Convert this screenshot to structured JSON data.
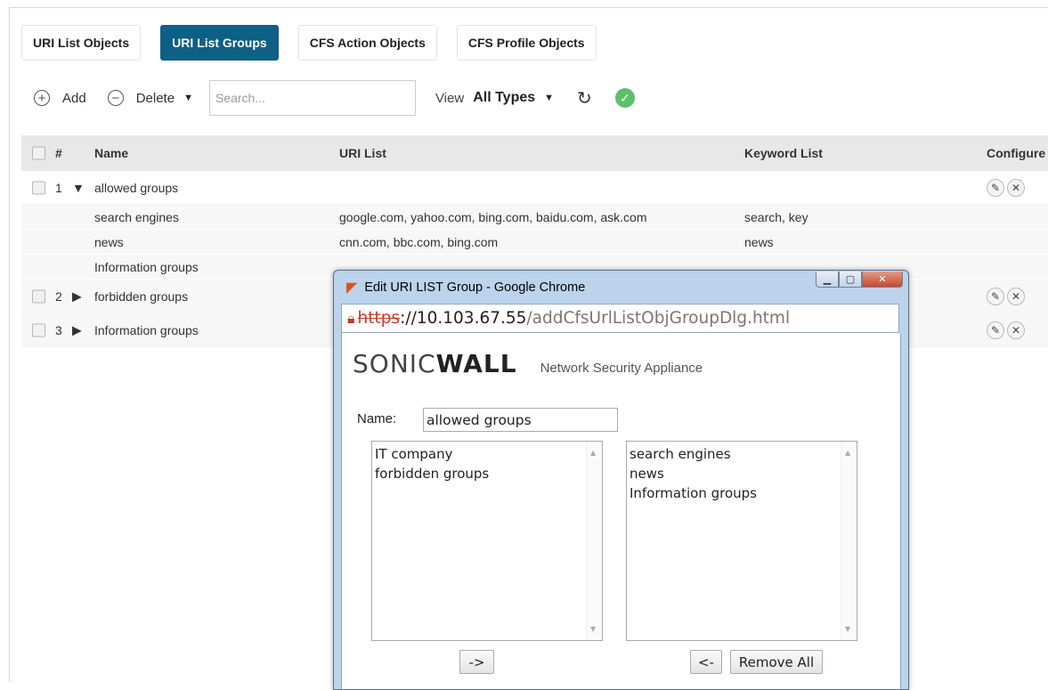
{
  "tabs": [
    {
      "label": "URI List Objects",
      "active": false
    },
    {
      "label": "URI List Groups",
      "active": true
    },
    {
      "label": "CFS Action Objects",
      "active": false
    },
    {
      "label": "CFS Profile Objects",
      "active": false
    }
  ],
  "toolbar": {
    "add_label": "Add",
    "delete_label": "Delete",
    "search_placeholder": "Search...",
    "view_label": "View",
    "view_value": "All Types"
  },
  "table": {
    "headers": {
      "num": "#",
      "name": "Name",
      "uri": "URI List",
      "keyword": "Keyword List",
      "configure": "Configure"
    },
    "groups": [
      {
        "num": "1",
        "name": "allowed groups",
        "expanded": true,
        "children": [
          {
            "name": "search engines",
            "uri": "google.com, yahoo.com, bing.com, baidu.com, ask.com",
            "keyword": "search, key"
          },
          {
            "name": "news",
            "uri": "cnn.com, bbc.com, bing.com",
            "keyword": "news"
          },
          {
            "name": "Information groups",
            "uri": "",
            "keyword": ""
          }
        ]
      },
      {
        "num": "2",
        "name": "forbidden groups",
        "expanded": false
      },
      {
        "num": "3",
        "name": "Information groups",
        "expanded": false
      }
    ]
  },
  "dialog": {
    "title": "Edit URI LIST Group - Google Chrome",
    "url_protocol": "https",
    "url_host": "://10.103.67.55",
    "url_path": "/addCfsUrlListObjGroupDlg.html",
    "brand_prefix": "SONIC",
    "brand_bold": "WALL",
    "brand_sub": "Network Security Appliance",
    "name_label": "Name:",
    "name_value": "allowed groups",
    "available": [
      "IT company",
      "forbidden groups"
    ],
    "selected": [
      "search engines",
      "news",
      "Information groups"
    ],
    "add_button": "->",
    "remove_button": "<-",
    "remove_all_button": "Remove All"
  },
  "colors": {
    "active_tab": "#0d5f86",
    "status_ok": "#5fbe6a",
    "header_bg": "#e8e8e8"
  }
}
